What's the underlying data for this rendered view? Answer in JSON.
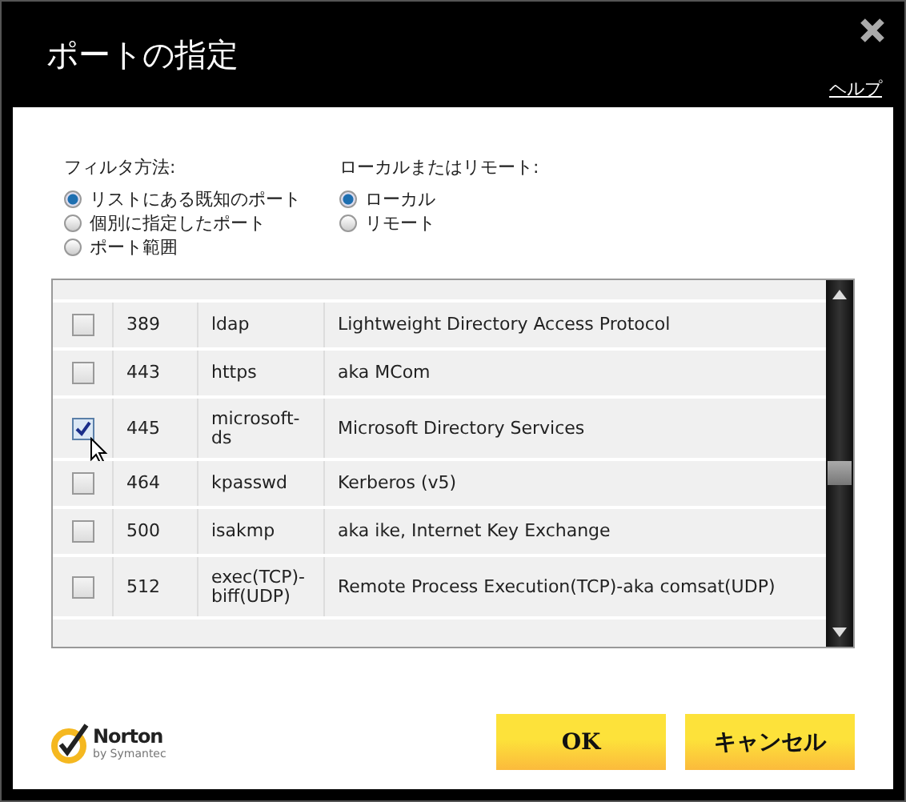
{
  "window": {
    "title": "ポートの指定",
    "help_link": "ヘルプ"
  },
  "filter": {
    "label": "フィルタ方法:",
    "options": [
      {
        "label": "リストにある既知のポート",
        "selected": true
      },
      {
        "label": "個別に指定したポート",
        "selected": false
      },
      {
        "label": "ポート範囲",
        "selected": false
      }
    ]
  },
  "scope": {
    "label": "ローカルまたはリモート:",
    "options": [
      {
        "label": "ローカル",
        "selected": true
      },
      {
        "label": "リモート",
        "selected": false
      }
    ]
  },
  "ports": [
    {
      "port": "389",
      "name": "ldap",
      "description": "Lightweight Directory Access Protocol",
      "checked": false
    },
    {
      "port": "443",
      "name": "https",
      "description": "aka MCom",
      "checked": false
    },
    {
      "port": "445",
      "name": "microsoft-ds",
      "description": "Microsoft Directory Services",
      "checked": true
    },
    {
      "port": "464",
      "name": "kpasswd",
      "description": "Kerberos (v5)",
      "checked": false
    },
    {
      "port": "500",
      "name": "isakmp",
      "description": "aka ike, Internet Key Exchange",
      "checked": false
    },
    {
      "port": "512",
      "name": "exec(TCP)-biff(UDP)",
      "description": "Remote Process Execution(TCP)-aka comsat(UDP)",
      "checked": false
    }
  ],
  "logo": {
    "brand": "Norton",
    "tagline": "by Symantec"
  },
  "buttons": [
    "OK",
    "キャンセル"
  ]
}
